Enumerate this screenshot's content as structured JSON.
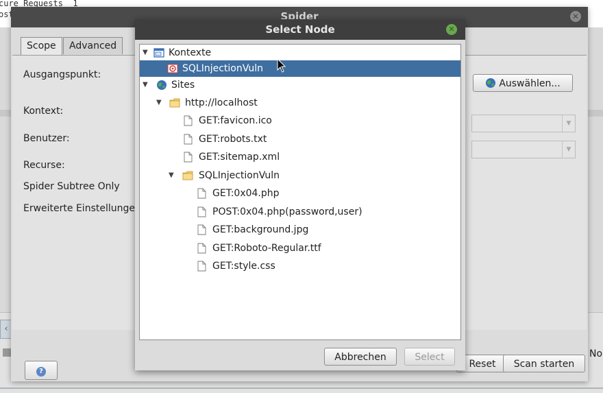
{
  "background": {
    "code_lines": [
      "cure Requests  1",
      "ost"
    ]
  },
  "spider": {
    "title": "Spider",
    "tabs": [
      {
        "label": "Scope",
        "active": true
      },
      {
        "label": "Advanced",
        "active": false
      }
    ],
    "fields": {
      "start_point": "Ausgangspunkt:",
      "context": "Kontext:",
      "user": "Benutzer:",
      "recurse": "Recurse:",
      "subtree_only": "Spider Subtree Only",
      "advanced_options": "Erweiterte Einstellunge"
    },
    "select_button": "Auswählen...",
    "reset_button": "Reset",
    "scan_button": "Scan starten"
  },
  "background_right_label": "No",
  "select_node": {
    "title": "Select Node",
    "cancel_button": "Abbrechen",
    "select_button": "Select",
    "tree": [
      {
        "label": "Kontexte",
        "icon": "contexts-icon",
        "expanded": true
      },
      {
        "label": "SQLInjectionVuln",
        "icon": "context-target-icon",
        "selected": true
      },
      {
        "label": "Sites",
        "icon": "globe-icon",
        "expanded": true
      },
      {
        "label": "http://localhost",
        "icon": "folder-icon",
        "expanded": true
      },
      {
        "label": "GET:favicon.ico",
        "icon": "file-icon"
      },
      {
        "label": "GET:robots.txt",
        "icon": "file-icon"
      },
      {
        "label": "GET:sitemap.xml",
        "icon": "file-icon"
      },
      {
        "label": "SQLInjectionVuln",
        "icon": "folder-icon",
        "expanded": true
      },
      {
        "label": "GET:0x04.php",
        "icon": "file-icon"
      },
      {
        "label": "POST:0x04.php(password,user)",
        "icon": "file-icon"
      },
      {
        "label": "GET:background.jpg",
        "icon": "file-icon"
      },
      {
        "label": "GET:Roboto-Regular.ttf",
        "icon": "file-icon"
      },
      {
        "label": "GET:style.css",
        "icon": "file-icon"
      }
    ]
  },
  "colors": {
    "selection": "#3f6ea0",
    "title_bar": "#3e3e3e",
    "close_green": "#6aa84f"
  }
}
